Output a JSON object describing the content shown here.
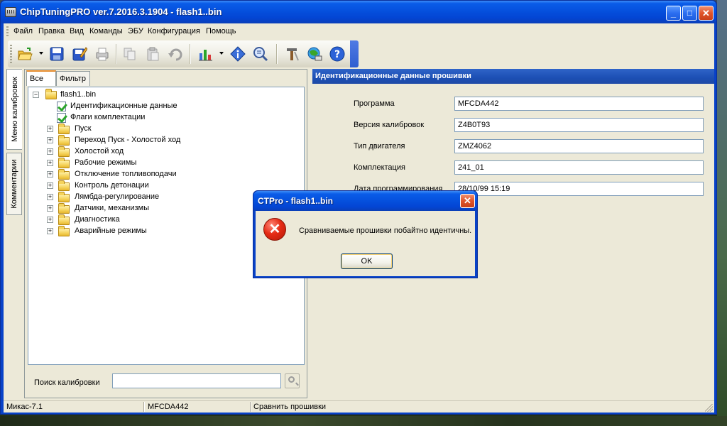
{
  "window": {
    "title": "ChipTuningPRO ver.7.2016.3.1904 - flash1..bin",
    "min": "_",
    "max": "□",
    "close": "✕"
  },
  "menu": [
    "Файл",
    "Правка",
    "Вид",
    "Команды",
    "ЭБУ",
    "Конфигурация",
    "Помощь"
  ],
  "toolbar": [
    "open-folder-icon",
    "save-icon",
    "save-as-icon",
    "print-icon",
    "copy-icon",
    "paste-icon",
    "undo-icon",
    "chart-icon",
    "info-icon",
    "compare-icon",
    "tools-icon",
    "network-icon",
    "help-icon"
  ],
  "side_tabs": [
    "Меню калибровок",
    "Комментарии"
  ],
  "tabs": [
    "Все",
    "Фильтр"
  ],
  "tree": {
    "root": "flash1..bin",
    "root_expander": "−",
    "leaves": [
      "Идентификационные данные",
      "Флаги комплектации"
    ],
    "folders": [
      "Пуск",
      "Переход Пуск - Холостой ход",
      "Холостой ход",
      "Рабочие режимы",
      "Отключение топливоподачи",
      "Контроль детонации",
      "Лямбда-регулирование",
      "Датчики, механизмы",
      "Диагностика",
      "Аварийные режимы"
    ],
    "expander": "+"
  },
  "search": {
    "label": "Поиск калибровки",
    "value": ""
  },
  "right": {
    "header": "Идентификационные данные прошивки",
    "fields": [
      {
        "label": "Программа",
        "value": "MFCDA442"
      },
      {
        "label": "Версия калибровок",
        "value": "Z4B0T93"
      },
      {
        "label": "Тип двигателя",
        "value": "ZMZ4062"
      },
      {
        "label": "Комплектация",
        "value": "241_01"
      },
      {
        "label": "Дата программирования",
        "value": "28/10/99 15:19"
      }
    ]
  },
  "status": [
    "Микас-7.1",
    "MFCDA442",
    "Сравнить прошивки"
  ],
  "dialog": {
    "title": "CTPro - flash1..bin",
    "close": "✕",
    "icon": "✕",
    "message": "Сравниваемые прошивки побайтно идентичны.",
    "ok": "OK"
  },
  "colors": {
    "title_blue": "#0550dd",
    "panel_header": "#1c4fb4",
    "face": "#ece9d8",
    "error_red": "#e52b14"
  }
}
